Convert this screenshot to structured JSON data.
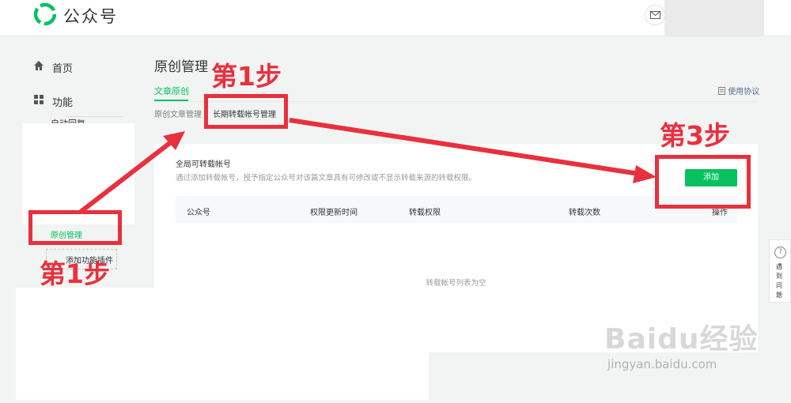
{
  "header": {
    "app_name": "公众号"
  },
  "sidebar": {
    "home": "首页",
    "features": "功能",
    "sub_hidden": "自动回复",
    "active": "原创管理",
    "add_plugin": "添加功能插件"
  },
  "main": {
    "title": "原创管理",
    "tab_active": "文章原创",
    "terms": "使用协议",
    "subtabs": [
      "原创文章管理",
      "长期转载帐号管理"
    ]
  },
  "panel": {
    "title": "全局可转载帐号",
    "desc": "通过添加转载帐号，授予指定公众号对该篇文章具有可修改或不显示转载来源的转载权限。",
    "add_label": "添加",
    "columns": [
      "公众号",
      "权限更新时间",
      "转载权限",
      "转载次数",
      "操作"
    ],
    "empty": "转载帐号列表为空"
  },
  "help": {
    "label": "遇到问题"
  },
  "annotations": {
    "step1": "第1步",
    "step3": "第3步"
  },
  "watermark": {
    "text": "Baidu经验",
    "url": "jingyan.baidu.com"
  },
  "colors": {
    "accent": "#07c160",
    "annotation": "#e8303f"
  }
}
